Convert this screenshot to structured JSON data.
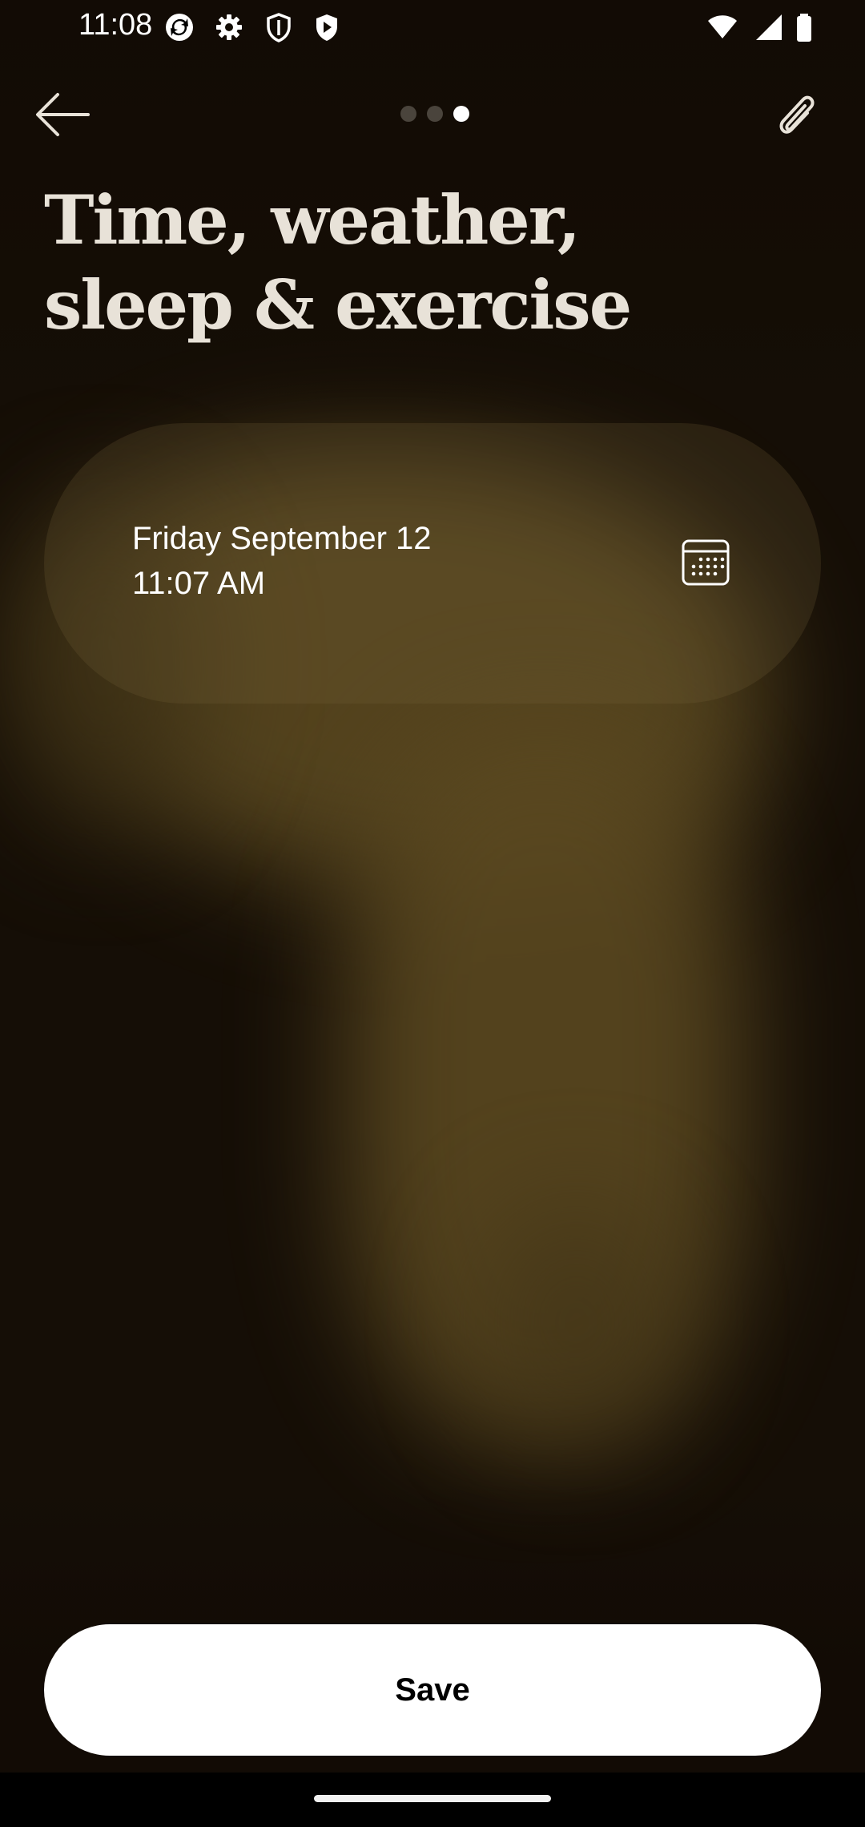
{
  "status_bar": {
    "time": "11:08",
    "icons": [
      "sync-icon",
      "settings-gear-icon",
      "shield-icon",
      "play-protect-icon",
      "wifi-icon",
      "signal-icon",
      "battery-icon"
    ]
  },
  "top_bar": {
    "back_icon": "arrow-left-icon",
    "attach_icon": "paperclip-icon",
    "pager": {
      "total": 3,
      "active": 3
    }
  },
  "page": {
    "title_line1": "Time, weather,",
    "title_line2": "sleep & exercise"
  },
  "date_card": {
    "date": "Friday September 12",
    "time": "11:07 AM",
    "icon": "calendar-icon"
  },
  "footer": {
    "save_label": "Save"
  },
  "colors": {
    "background": "#150e06",
    "glow": "#5e4c22",
    "button": "#ffffff"
  }
}
